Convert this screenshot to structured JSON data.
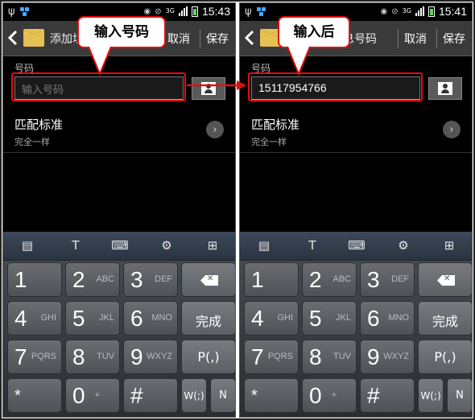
{
  "left": {
    "status": {
      "time": "15:43",
      "network": "3G"
    },
    "action_bar": {
      "title": "添加垃圾号码",
      "cancel": "取消",
      "save": "保存"
    },
    "field_label": "号码",
    "number_placeholder": "输入号码",
    "match": {
      "title": "匹配标准",
      "value": "完全一样"
    },
    "callout": "输入号码"
  },
  "right": {
    "status": {
      "time": "15:41",
      "network": "3G"
    },
    "action_bar": {
      "title": "添加垃圾信息号码",
      "cancel": "取消",
      "save": "保存"
    },
    "field_label": "号码",
    "number_value": "15117954766",
    "match": {
      "title": "匹配标准",
      "value": "完全一样"
    },
    "callout": "输入后"
  },
  "keyboard": {
    "toolbar": [
      "clipboard-icon",
      "text-recognition-icon",
      "keyboard-icon",
      "settings-icon",
      "keyboard-settings-icon"
    ],
    "keys": {
      "k1": {
        "digit": "1",
        "letters": ""
      },
      "k2": {
        "digit": "2",
        "letters": "ABC"
      },
      "k3": {
        "digit": "3",
        "letters": "DEF"
      },
      "k4": {
        "digit": "4",
        "letters": "GHI"
      },
      "k5": {
        "digit": "5",
        "letters": "JKL"
      },
      "k6": {
        "digit": "6",
        "letters": "MNO"
      },
      "k7": {
        "digit": "7",
        "letters": "PQRS"
      },
      "k8": {
        "digit": "8",
        "letters": "TUV"
      },
      "k9": {
        "digit": "9",
        "letters": "WXYZ"
      },
      "kstar": {
        "digit": "*",
        "letters": ""
      },
      "k0": {
        "digit": "0",
        "letters": "+"
      },
      "khash": {
        "digit": "#",
        "letters": ""
      }
    },
    "done": "完成",
    "pause": "P(,)",
    "wait": "W(;)",
    "n": "N"
  },
  "colors": {
    "highlight": "#e01010",
    "action_bar": "#3a3a3a",
    "keyboard_toolbar": "#2f3a48"
  }
}
